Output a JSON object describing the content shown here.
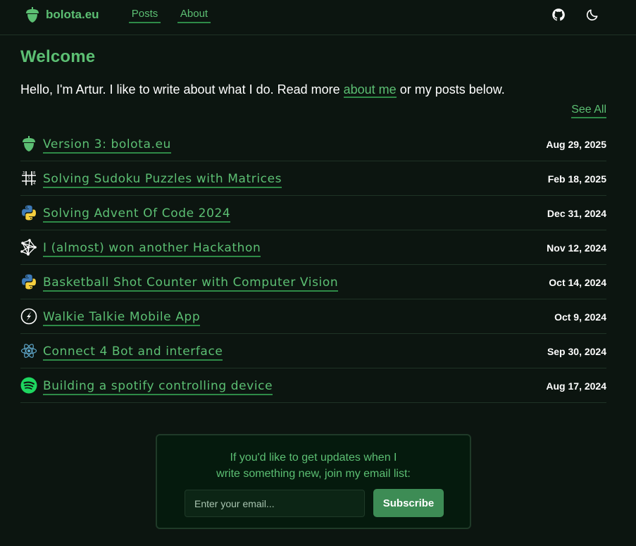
{
  "header": {
    "brand": "bolota.eu",
    "logo_icon": "acorn-icon",
    "nav": [
      {
        "label": "Posts"
      },
      {
        "label": "About"
      }
    ],
    "icons": [
      "github-icon",
      "moon-icon"
    ]
  },
  "main": {
    "welcome": "Welcome",
    "intro_before": "Hello, I'm Artur. I like to write about what I do. Read more ",
    "intro_link": "about me",
    "intro_after": " or my posts below.",
    "see_all": "See All"
  },
  "posts": [
    {
      "icon": "acorn-icon",
      "title": "Version 3: bolota.eu",
      "date": "Aug 29, 2025"
    },
    {
      "icon": "sudoku-grid-icon",
      "title": "Solving Sudoku Puzzles with Matrices",
      "date": "Feb 18, 2025"
    },
    {
      "icon": "python-icon",
      "title": "Solving Advent Of Code 2024",
      "date": "Dec 31, 2024"
    },
    {
      "icon": "network-graph-icon",
      "title": "I (almost) won another Hackathon",
      "date": "Nov 12, 2024"
    },
    {
      "icon": "python-icon",
      "title": "Basketball Shot Counter with Computer Vision",
      "date": "Oct 14, 2024"
    },
    {
      "icon": "lightning-circle-icon",
      "title": "Walkie Talkie Mobile App",
      "date": "Oct 9, 2024"
    },
    {
      "icon": "react-icon",
      "title": "Connect 4 Bot and interface",
      "date": "Sep 30, 2024"
    },
    {
      "icon": "spotify-icon",
      "title": "Building a spotify controlling device",
      "date": "Aug 17, 2024"
    }
  ],
  "newsletter": {
    "line1": "If you'd like to get updates when I",
    "line2": "write something new, join my email list:",
    "email_placeholder": "Enter your email...",
    "button": "Subscribe"
  },
  "colors": {
    "background": "#0c1510",
    "accent": "#5cbf73",
    "underline": "#2e8a47",
    "button": "#3d8c55"
  }
}
